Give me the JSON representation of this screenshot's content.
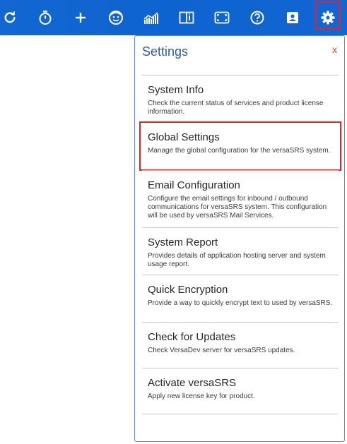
{
  "toolbar": {
    "icons": [
      "refresh-icon",
      "stopwatch-icon",
      "plus-icon",
      "face-icon",
      "chart-icon",
      "book-icon",
      "expand-icon",
      "help-icon",
      "contact-icon",
      "gear-icon"
    ],
    "accent_color": "#1367d3",
    "highlight_color": "#e0242b"
  },
  "panel": {
    "title": "Settings",
    "close_label": "x",
    "items": [
      {
        "title": "System Info",
        "description": "Check the current status of services and product license information."
      },
      {
        "title": "Global Settings",
        "description": "Manage the global configuration for the versaSRS system."
      },
      {
        "title": "Email Configuration",
        "description": "Configure the email settings for inbound / outbound communications for versaSRS system. This configuration will be used by versaSRS Mail Services."
      },
      {
        "title": "System Report",
        "description": "Provides details of application hosting server and system usage report."
      },
      {
        "title": "Quick Encryption",
        "description": "Provide a way to quickly encrypt text to used by versaSRS."
      },
      {
        "title": "Check for Updates",
        "description": "Check VersaDev server for versaSRS updates."
      },
      {
        "title": "Activate versaSRS",
        "description": "Apply new license key for product."
      }
    ]
  }
}
